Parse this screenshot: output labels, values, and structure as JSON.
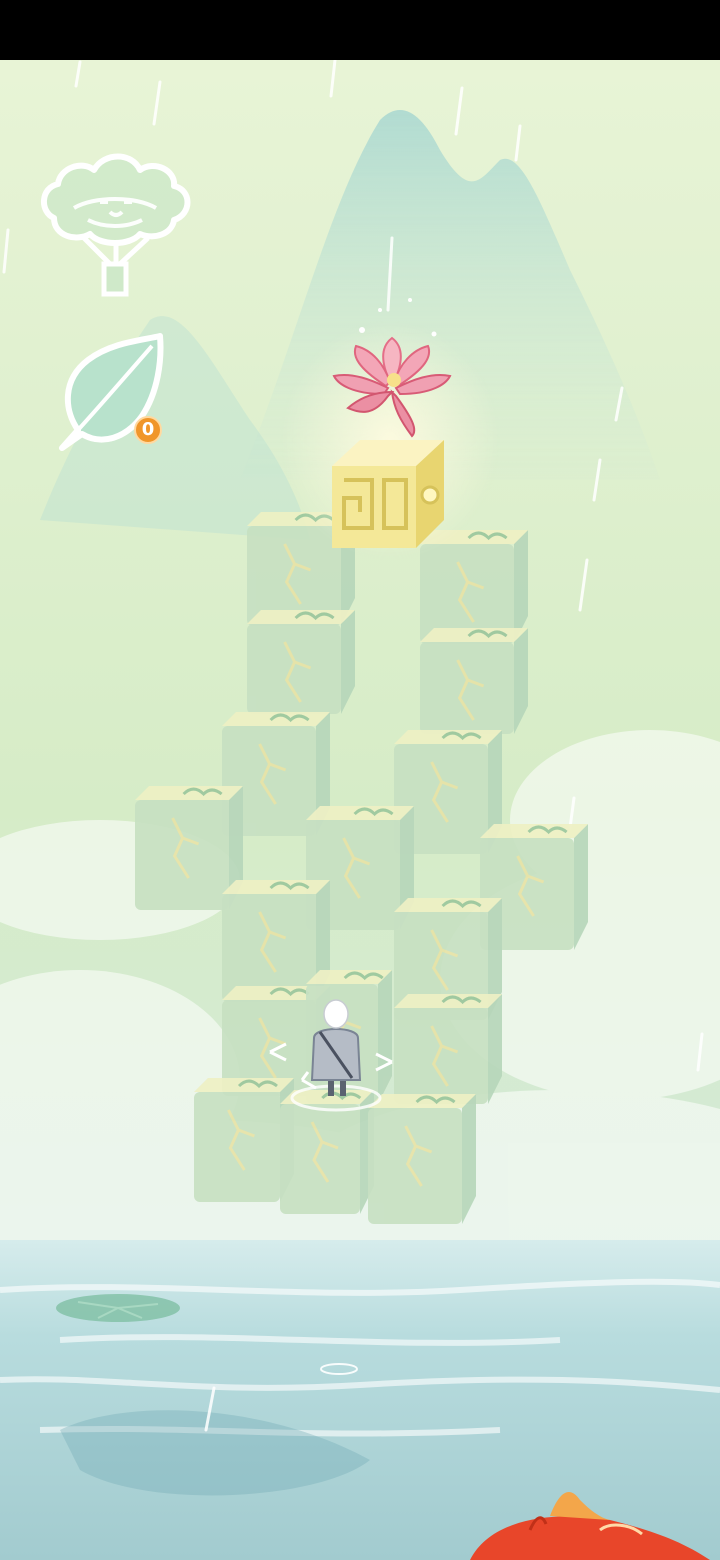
{
  "hud": {
    "flower_button_icon": "cloud-flower-icon",
    "leaf_button_icon": "leaf-icon",
    "leaf_count": "0"
  },
  "colors": {
    "sky_top": "#e6f3d4",
    "sky_mid": "#d3ebc6",
    "mountain": "#a8d8cf",
    "block_top": "#eef0c4",
    "block_side": "#b7d6ba",
    "block_front": "#c7e0c2",
    "goal_block": "#f6eeaa",
    "water": "#a7cfd2",
    "lotus": "#f2a3b2",
    "koi": "#e94a2c",
    "badge": "#f0962a"
  }
}
